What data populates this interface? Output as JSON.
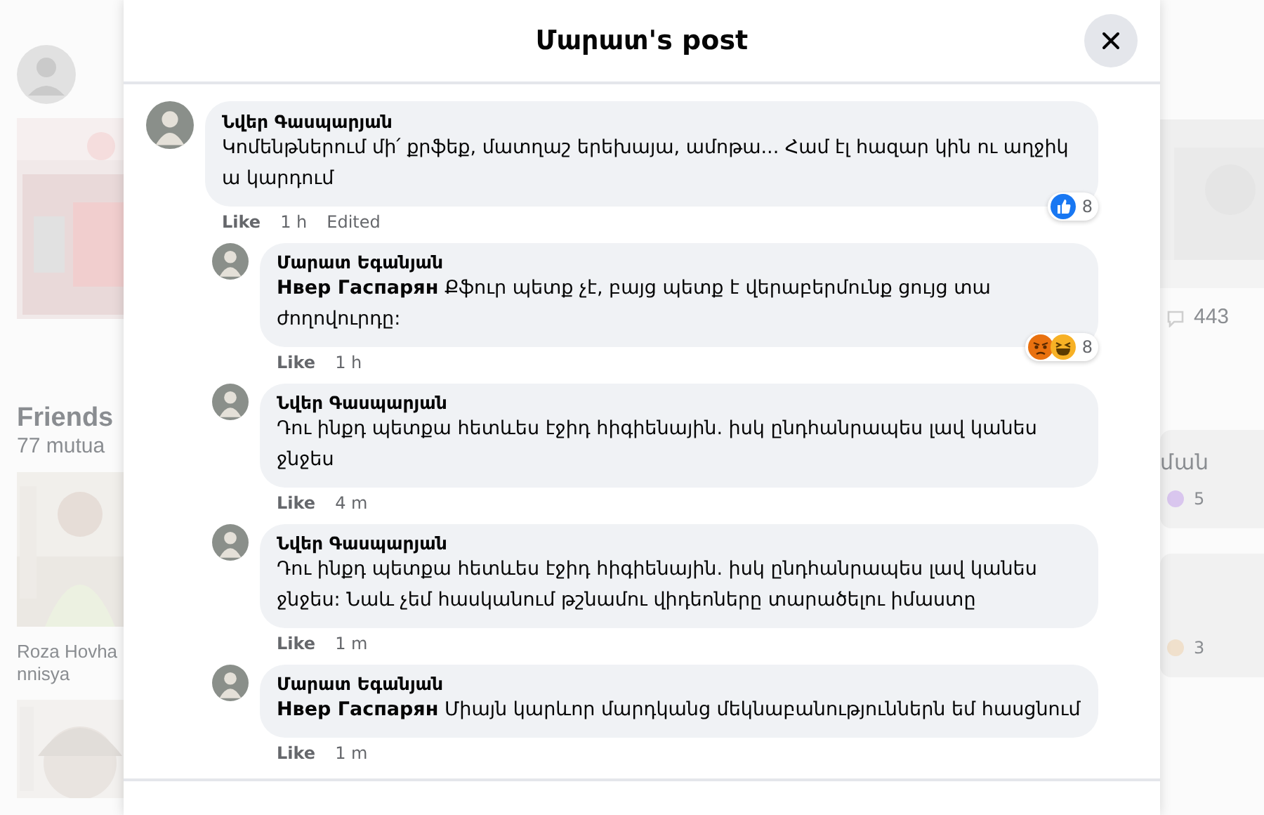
{
  "background": {
    "left": {
      "friends_title": "Friends",
      "friends_count": "77 mutua",
      "friend_name": "Roza Hovhannisya"
    },
    "right": {
      "comment_count": "443",
      "card_text": "ման",
      "reaction_count_1": "5",
      "reaction_count_2": "3"
    }
  },
  "dialog": {
    "title": "Մարատ's post",
    "comments": [
      {
        "author": "Նվեր Գասպարյան",
        "text": "Կոմենթներում մի՛ քրֆեք, մատղաշ երեխայա, ամոթա... Համ էլ հազար կին ու աղջիկ ա կարդում",
        "actions": [
          "Like",
          "1 h",
          "Edited"
        ],
        "reactions": {
          "items": [
            {
              "kind": "like"
            }
          ],
          "count": "8"
        },
        "replies": [
          {
            "author": "Մարատ Եգանյան",
            "mention": "Нвер Гаспарян",
            "text": "Քֆուր պետք չէ, բայց պետք է վերաբերմունք ցույց տա ժողովուրդը:",
            "actions": [
              "Like",
              "1 h"
            ],
            "reactions": {
              "items": [
                {
                  "kind": "angry"
                },
                {
                  "kind": "haha"
                }
              ],
              "count": "8"
            }
          },
          {
            "author": "Նվեր Գասպարյան",
            "text": "Դու ինքդ պետքա հետևես էջիդ հիգիենային. իսկ ընդհանրապես լավ կանես ջնջես",
            "actions": [
              "Like",
              "4 m"
            ]
          },
          {
            "author": "Նվեր Գասպարյան",
            "text": "Դու ինքդ պետքա հետևես էջիդ հիգիենային. իսկ ընդհանրապես լավ կանես ջնջես: Նաև չեմ հասկանում թշնամու վիդեոները տարածելու իմաստը",
            "actions": [
              "Like",
              "1 m"
            ]
          },
          {
            "author": "Մարատ Եգանյան",
            "mention": "Нвер Гаспарян",
            "text": "Միայն կարևոր մարդկանց մեկնաբանություններն եմ հասցնում",
            "actions": [
              "Like",
              "1 m"
            ]
          }
        ]
      }
    ]
  }
}
